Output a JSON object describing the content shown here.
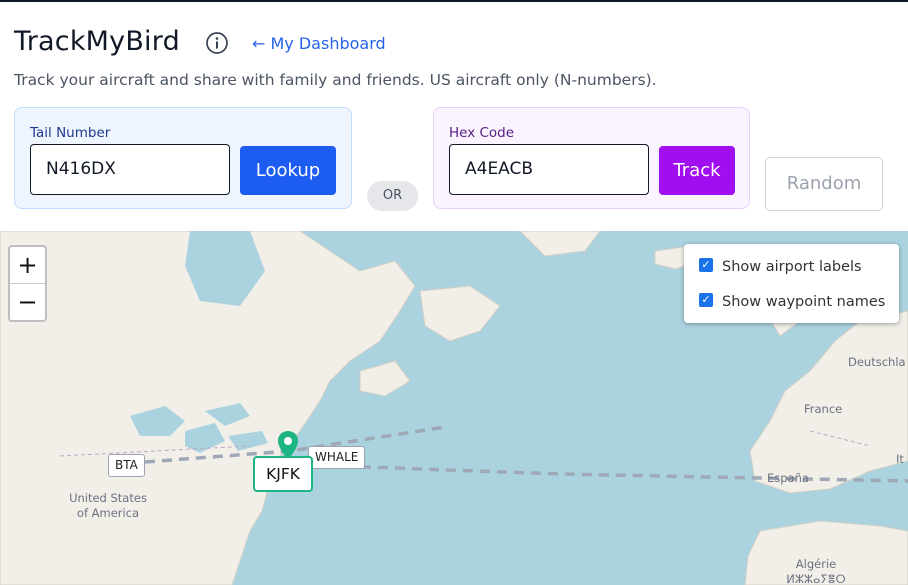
{
  "header": {
    "title": "TrackMyBird",
    "dashboard_link": "← My Dashboard",
    "subtitle": "Track your aircraft and share with family and friends. US aircraft only (N-numbers)."
  },
  "tail_panel": {
    "label": "Tail Number",
    "input_value": "N416DX",
    "button_label": "Lookup"
  },
  "or_label": "OR",
  "hex_panel": {
    "label": "Hex Code",
    "input_value": "A4EACB",
    "button_label": "Track"
  },
  "random_button": "Random",
  "map": {
    "zoom_in": "+",
    "zoom_out": "−",
    "layers": {
      "airport_labels": {
        "label": "Show airport labels",
        "checked": true
      },
      "waypoint_names": {
        "label": "Show waypoint names",
        "checked": true
      }
    },
    "waypoints": {
      "bta": "BTA",
      "whale": "WHALE"
    },
    "airport": "KJFK",
    "place_labels": {
      "usa_line1": "United States",
      "usa_line2": "of America",
      "france": "France",
      "spain": "España",
      "germany": "Deutschla",
      "italy": "It",
      "algeria_line1": "Algérie",
      "algeria_line2": "ⵍⵣⵣⴰⵢⴻⵔ"
    }
  },
  "colors": {
    "lookup_button": "#1d5cf0",
    "track_button": "#a10ef0",
    "airport_marker": "#1db584",
    "link": "#2563eb",
    "ocean": "#aad3df"
  },
  "icons": {
    "info": "info-circle-icon",
    "pin": "map-pin-icon",
    "checkbox": "check-icon"
  }
}
